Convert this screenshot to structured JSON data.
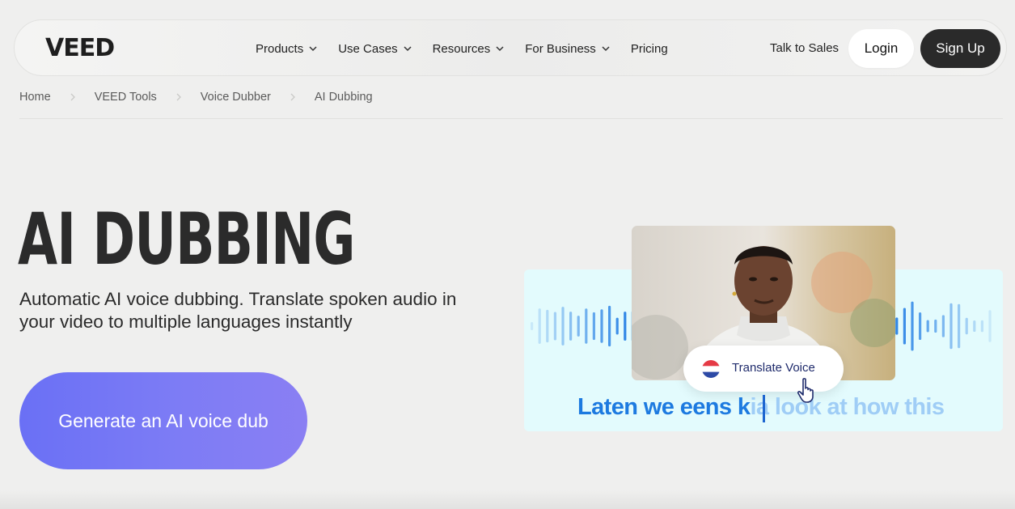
{
  "nav": {
    "logo": "VEED",
    "menu": [
      {
        "label": "Products",
        "has_dropdown": true
      },
      {
        "label": "Use Cases",
        "has_dropdown": true
      },
      {
        "label": "Resources",
        "has_dropdown": true
      },
      {
        "label": "For Business",
        "has_dropdown": true
      },
      {
        "label": "Pricing",
        "has_dropdown": false
      }
    ],
    "talk_to_sales": "Talk to Sales",
    "login": "Login",
    "signup": "Sign Up"
  },
  "breadcrumb": [
    "Home",
    "VEED Tools",
    "Voice Dubber",
    "AI Dubbing"
  ],
  "hero": {
    "title": "AI DUBBING",
    "subtitle": "Automatic AI voice dubbing. Translate spoken audio in your video to multiple languages instantly",
    "cta": "Generate an AI voice dub"
  },
  "illustration": {
    "pill_label": "Translate Voice",
    "caption_spoken": "Laten we eens k",
    "caption_pending": "ia look at how this",
    "colors": {
      "panel": "#e3fbfd",
      "wave": "#2f86e6",
      "caption": "#1d7ae0",
      "cta_start": "#6a70f5",
      "cta_end": "#8a7ff3"
    }
  },
  "icons": {
    "chevron": "chevron-down-icon",
    "separator": "chevron-right-icon",
    "flag": "netherlands-flag-icon",
    "cursor": "hand-pointer-icon"
  }
}
